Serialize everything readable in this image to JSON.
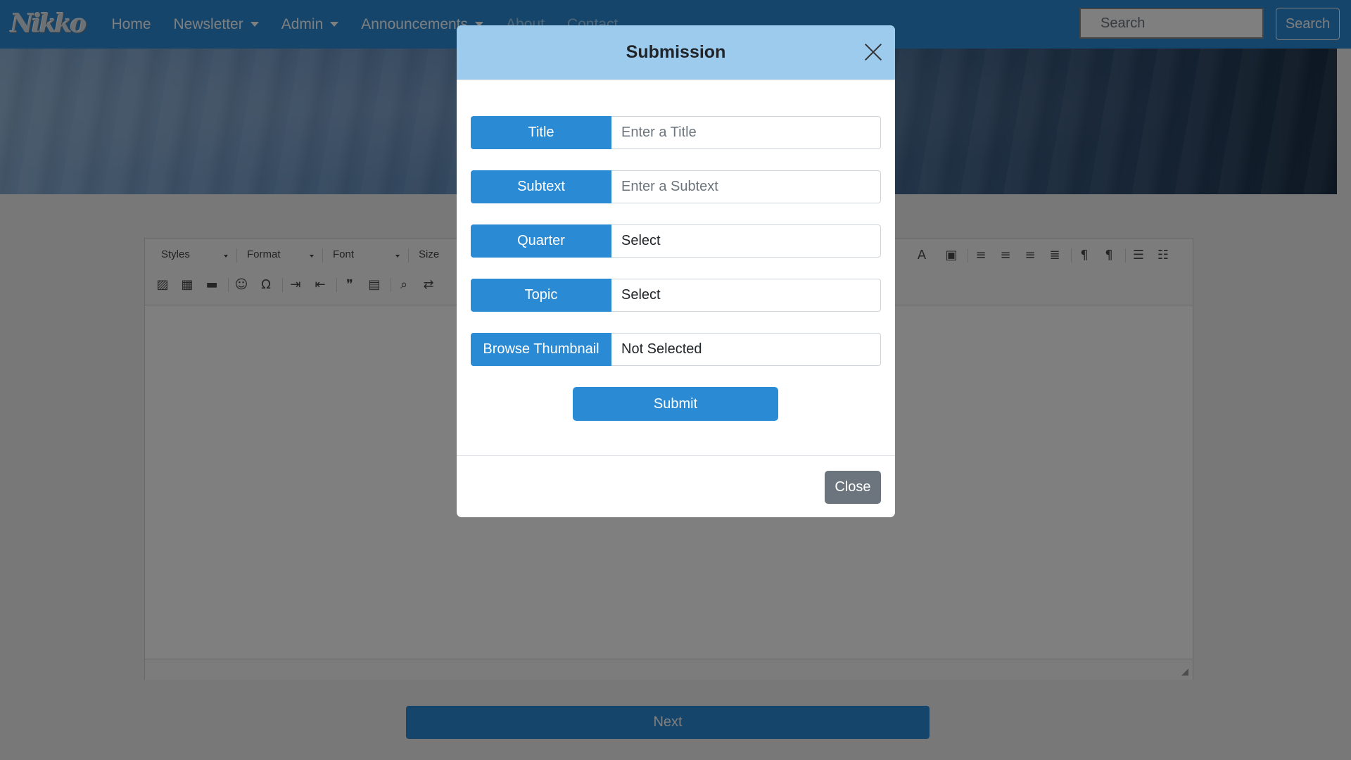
{
  "navbar": {
    "logo": "Nikko",
    "items": [
      {
        "label": "Home",
        "dropdown": false
      },
      {
        "label": "Newsletter",
        "dropdown": true
      },
      {
        "label": "Admin",
        "dropdown": true
      },
      {
        "label": "Announcements",
        "dropdown": true
      },
      {
        "label": "About",
        "dropdown": false
      },
      {
        "label": "Contact",
        "dropdown": false
      }
    ],
    "search_placeholder": "Search",
    "search_button": "Search",
    "color": "#2a8ad4"
  },
  "editor": {
    "combos": [
      "Styles",
      "Format",
      "Font",
      "Size"
    ],
    "icons_row1": [
      "font-color-icon",
      "background-color-icon",
      "align-left-icon",
      "align-center-icon",
      "align-right-icon",
      "justify-icon",
      "ltr-icon",
      "rtl-icon",
      "numbered-list-icon",
      "bulleted-list-icon"
    ],
    "icons_row2": [
      "image-icon",
      "table-icon",
      "horizontal-line-icon",
      "smiley-icon",
      "special-char-icon",
      "indent-icon",
      "outdent-icon",
      "blockquote-icon",
      "div-icon",
      "find-icon",
      "replace-icon"
    ]
  },
  "next_button": "Next",
  "modal": {
    "title": "Submission",
    "rows": [
      {
        "label": "Title",
        "placeholder": "Enter a Title",
        "value": ""
      },
      {
        "label": "Subtext",
        "placeholder": "Enter a Subtext",
        "value": ""
      },
      {
        "label": "Quarter",
        "value": "Select"
      },
      {
        "label": "Topic",
        "value": "Select"
      },
      {
        "label": "Browse Thumbnail",
        "value": "Not Selected"
      }
    ],
    "submit": "Submit",
    "close": "Close"
  }
}
